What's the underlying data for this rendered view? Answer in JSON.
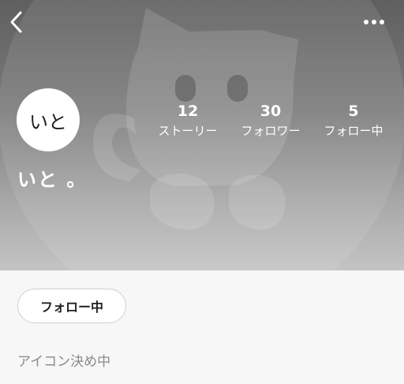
{
  "header": {
    "back_icon": "chevron-left-icon",
    "more_icon": "more-horizontal-icon",
    "background_art": "cat-silhouette"
  },
  "profile": {
    "avatar_text": "いと",
    "display_name": "いと 。",
    "bio": "アイコン決め中"
  },
  "stats": [
    {
      "value": "12",
      "label": "ストーリー"
    },
    {
      "value": "30",
      "label": "フォロワー"
    },
    {
      "value": "5",
      "label": "フォロー中"
    }
  ],
  "actions": {
    "follow_label": "フォロー中"
  },
  "colors": {
    "header_dark": "#5f5f5f",
    "header_light": "#c4c4c4",
    "page_bg": "#f7f7f7",
    "bio_text": "#8a8a8a"
  }
}
